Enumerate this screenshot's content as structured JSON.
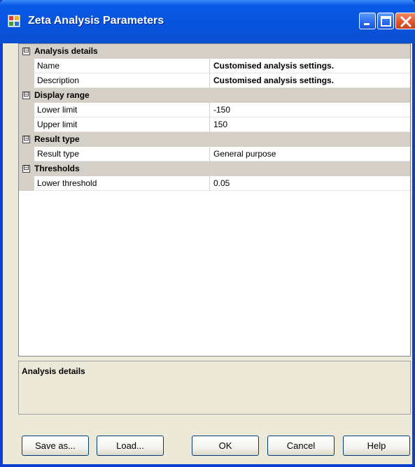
{
  "window": {
    "title": "Zeta Analysis Parameters"
  },
  "grid": {
    "categories": [
      {
        "label": "Analysis details",
        "toggle": "⊟",
        "properties": [
          {
            "name": "Name",
            "value": "Customised analysis settings."
          },
          {
            "name": "Description",
            "value": "Customised analysis settings."
          }
        ]
      },
      {
        "label": "Display range",
        "toggle": "⊟",
        "properties": [
          {
            "name": "Lower limit",
            "value": "-150"
          },
          {
            "name": "Upper limit",
            "value": "150"
          }
        ]
      },
      {
        "label": "Result type",
        "toggle": "⊟",
        "properties": [
          {
            "name": "Result type",
            "value": "General purpose"
          }
        ]
      },
      {
        "label": "Thresholds",
        "toggle": "⊟",
        "properties": [
          {
            "name": "Lower threshold",
            "value": "0.05"
          }
        ]
      }
    ]
  },
  "help_pane": {
    "title": "Analysis details"
  },
  "buttons": {
    "save_as": "Save as...",
    "load": "Load...",
    "ok": "OK",
    "cancel": "Cancel",
    "help": "Help"
  },
  "colors": {
    "titlebar": "#0653dd",
    "category_bg": "#d4d0c8",
    "dialog_bg": "#ece9d8"
  }
}
